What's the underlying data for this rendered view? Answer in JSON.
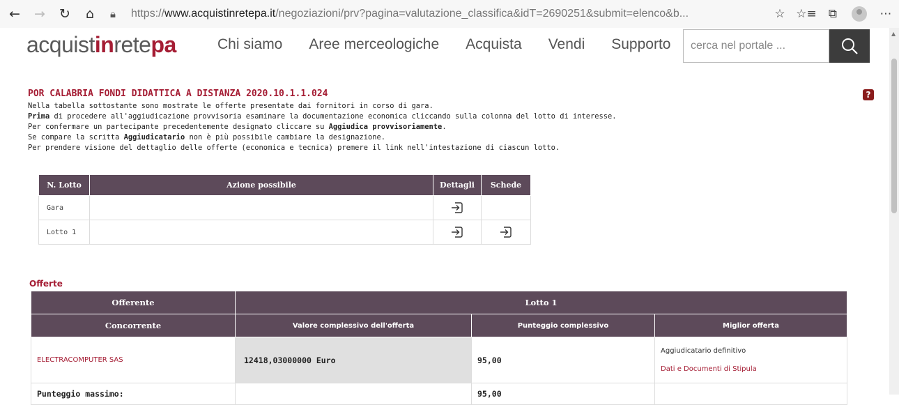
{
  "browser": {
    "url_prefix": "https://",
    "url_host": "www.acquistinretepa.it",
    "url_path": "/negoziazioni/prv?pagina=valutazione_classifica&idT=2690251&submit=elenco&b..."
  },
  "site": {
    "logo": {
      "part1": "acquist",
      "part2": "in",
      "part3": "rete",
      "part4": "pa"
    },
    "menu": [
      "Chi siamo",
      "Aree merceologiche",
      "Acquista",
      "Vendi",
      "Supporto"
    ],
    "search_placeholder": "cerca nel portale ..."
  },
  "page": {
    "title": "POR CALABRIA FONDI DIDATTICA A DISTANZA 2020.10.1.1.024",
    "instructions": {
      "line1": "Nella tabella sottostante sono mostrate le offerte presentate dai fornitori in corso di gara.",
      "line2_bold": "Prima",
      "line2_rest": " di procedere all'aggiudicazione provvisoria esaminare la documentazione economica cliccando sulla colonna del lotto di interesse.",
      "line3_pre": "Per confermare un partecipante precedentemente designato cliccare su ",
      "line3_bold": "Aggiudica provvisoriamente",
      "line3_post": ".",
      "line4_pre": "Se compare la scritta ",
      "line4_bold": "Aggiudicatario",
      "line4_post": " non è più possibile cambiare la designazione.",
      "line5": "Per prendere visione del dettaglio delle offerte (economica e tecnica) premere il link nell'intestazione di ciascun lotto."
    }
  },
  "lotti_table": {
    "headers": [
      "N. Lotto",
      "Azione possibile",
      "Dettagli",
      "Schede"
    ],
    "rows": [
      {
        "lotto": "Gara",
        "azione": "",
        "dettagli": true,
        "schede": false
      },
      {
        "lotto": "Lotto 1",
        "azione": "",
        "dettagli": true,
        "schede": true
      }
    ]
  },
  "offerte": {
    "section_title": "Offerte",
    "header1": {
      "offerente": "Offerente",
      "lotto": "Lotto 1"
    },
    "header2": {
      "concorrente": "Concorrente",
      "valore": "Valore complessivo dell'offerta",
      "punteggio": "Punteggio complessivo",
      "miglior": "Miglior offerta"
    },
    "rows": [
      {
        "concorrente": "ELECTRACOMPUTER SAS",
        "valore": "12418,03000000 Euro",
        "punteggio": "95,00",
        "status": "Aggiudicatario definitivo",
        "link": "Dati e Documenti di Stipula"
      }
    ],
    "max_label": "Punteggio massimo:",
    "max_value": "95,00"
  }
}
